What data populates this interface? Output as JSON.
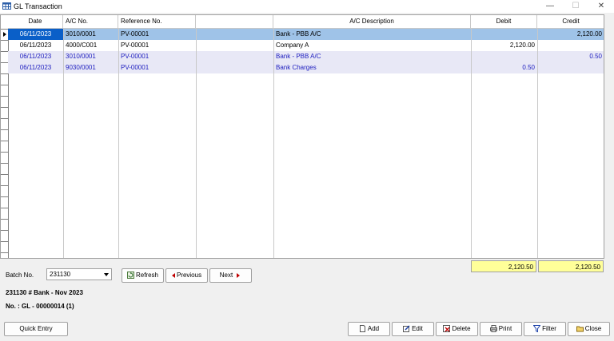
{
  "window": {
    "title": "GL Transaction",
    "min_glyph": "—",
    "max_glyph": "☐",
    "close_glyph": "✕"
  },
  "grid": {
    "columns": [
      "Date",
      "A/C No.",
      "Reference No.",
      "",
      "A/C Description",
      "Debit",
      "Credit"
    ],
    "rows": [
      {
        "date": "06/11/2023",
        "ac": "3010/0001",
        "ref": "PV-00001",
        "desc": "Bank - PBB A/C",
        "debit": "",
        "credit": "2,120.00"
      },
      {
        "date": "06/11/2023",
        "ac": "4000/C001",
        "ref": "PV-00001",
        "desc": "Company A",
        "debit": "2,120.00",
        "credit": ""
      },
      {
        "date": "06/11/2023",
        "ac": "3010/0001",
        "ref": "PV-00001",
        "desc": "Bank - PBB A/C",
        "debit": "",
        "credit": "0.50"
      },
      {
        "date": "06/11/2023",
        "ac": "9030/0001",
        "ref": "PV-00001",
        "desc": "Bank Charges",
        "debit": "0.50",
        "credit": ""
      }
    ],
    "selected_row": 0
  },
  "totals": {
    "debit": "2,120.50",
    "credit": "2,120.50"
  },
  "batch": {
    "label": "Batch No.",
    "value": "231130",
    "description": "231130 # Bank - Nov 2023",
    "number_line": "No. : GL - 00000014 (1)"
  },
  "nav": {
    "refresh": "Refresh",
    "previous": "Previous",
    "next": "Next"
  },
  "buttons": {
    "quick_entry": "Quick Entry",
    "add": "Add",
    "edit": "Edit",
    "delete": "Delete",
    "print": "Print",
    "filter": "Filter",
    "close": "Close"
  },
  "colors": {
    "selected_row": "#9fc3e8",
    "alt_row_text": "#2020c0",
    "totals_bg": "#ffff99"
  }
}
